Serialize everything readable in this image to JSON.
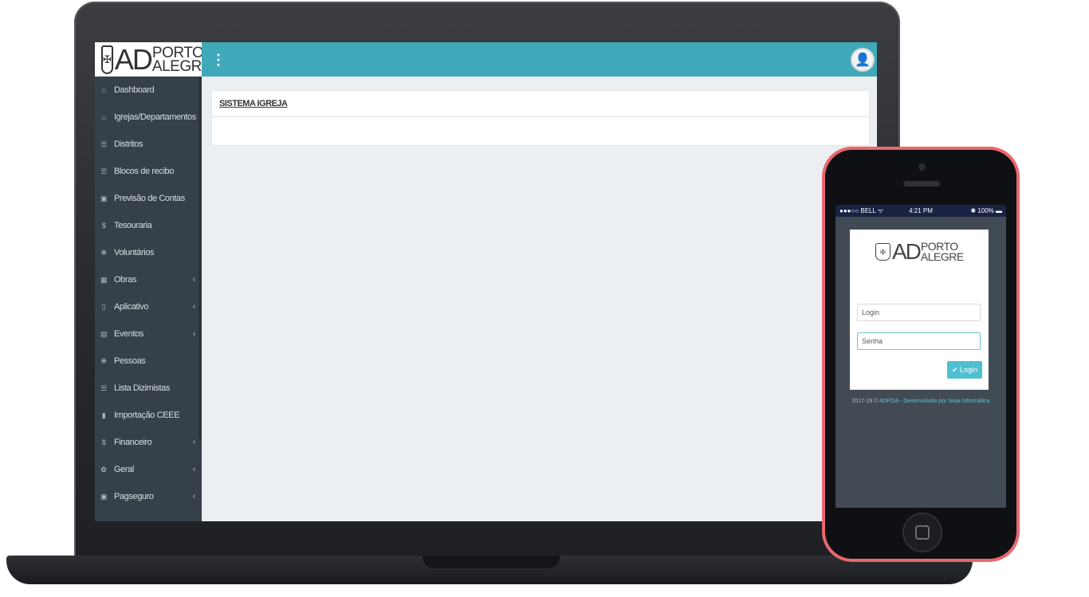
{
  "desktop": {
    "logo": {
      "ad": "AD",
      "line1": "PORTO",
      "line2": "ALEGRE"
    },
    "sidebar": {
      "items": [
        {
          "label": "Dashboard",
          "icon": "home-icon",
          "glyph": "⌂",
          "chevron": false
        },
        {
          "label": "Igrejas/Departamentos",
          "icon": "home-icon",
          "glyph": "⌂",
          "chevron": false
        },
        {
          "label": "Distritos",
          "icon": "list-icon",
          "glyph": "☰",
          "chevron": false
        },
        {
          "label": "Blocos de recibo",
          "icon": "list-icon",
          "glyph": "☰",
          "chevron": false
        },
        {
          "label": "Previsão de Contas",
          "icon": "money-icon",
          "glyph": "▣",
          "chevron": false
        },
        {
          "label": "Tesouraria",
          "icon": "dollar-icon",
          "glyph": "$",
          "chevron": false
        },
        {
          "label": "Voluntários",
          "icon": "users-icon",
          "glyph": "❋",
          "chevron": false
        },
        {
          "label": "Obras",
          "icon": "building-icon",
          "glyph": "▦",
          "chevron": true
        },
        {
          "label": "Aplicativo",
          "icon": "mobile-icon",
          "glyph": "▯",
          "chevron": true
        },
        {
          "label": "Eventos",
          "icon": "calendar-icon",
          "glyph": "▤",
          "chevron": true
        },
        {
          "label": "Pessoas",
          "icon": "users-icon",
          "glyph": "❋",
          "chevron": false
        },
        {
          "label": "Lista Dizimistas",
          "icon": "list-icon",
          "glyph": "☰",
          "chevron": false
        },
        {
          "label": "Importação CEEE",
          "icon": "file-icon",
          "glyph": "▮",
          "chevron": false
        },
        {
          "label": "Financeiro",
          "icon": "dollar-icon",
          "glyph": "$",
          "chevron": true
        },
        {
          "label": "Geral",
          "icon": "gear-icon",
          "glyph": "✿",
          "chevron": true
        },
        {
          "label": "Pagseguro",
          "icon": "money-icon",
          "glyph": "▣",
          "chevron": true
        }
      ]
    },
    "card": {
      "title": "SISTEMA IGREJA"
    },
    "colors": {
      "topbar": "#3fa9b9",
      "sidebar": "#36404a",
      "content_bg": "#eceff2"
    }
  },
  "mobile": {
    "status": {
      "carrier": "●●●○○ BELL ᯤ",
      "time": "4:21 PM",
      "battery": "✱ 100% ▬"
    },
    "logo": {
      "ad": "AD",
      "line1": "PORTO",
      "line2": "ALEGRE"
    },
    "login_placeholder": "Login",
    "password_placeholder": "Senha",
    "button_label": "✔ Login",
    "footer_prefix": "2017-19 © ",
    "footer_link": "ADPOA - Desenvolvido por Sinai Informática",
    "colors": {
      "frame": "#e8676e",
      "button": "#4fc0d0",
      "status_bar": "#1a2244"
    }
  }
}
